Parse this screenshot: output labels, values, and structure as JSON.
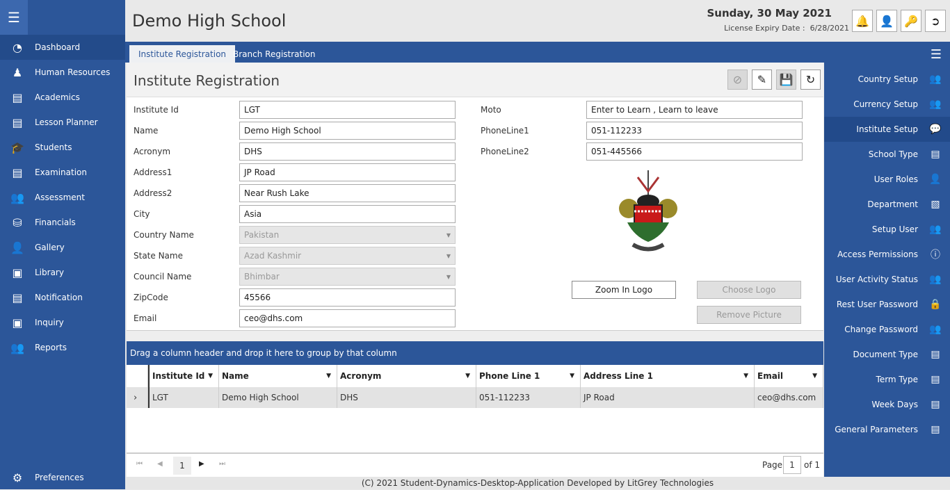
{
  "header": {
    "title": "Demo High School",
    "date": "Sunday, 30 May 2021",
    "license_label": "License Expiry Date :",
    "license_date": "6/28/2021"
  },
  "left_menu": [
    {
      "label": "Dashboard",
      "icon": "gauge-icon"
    },
    {
      "label": "Human Resources",
      "icon": "person-icon"
    },
    {
      "label": "Academics",
      "icon": "book-icon"
    },
    {
      "label": "Lesson Planner",
      "icon": "book-icon"
    },
    {
      "label": "Students",
      "icon": "graduate-icon"
    },
    {
      "label": "Examination",
      "icon": "list-icon"
    },
    {
      "label": "Assessment",
      "icon": "users-icon"
    },
    {
      "label": "Financials",
      "icon": "coins-icon"
    },
    {
      "label": "Gallery",
      "icon": "user-edit-icon"
    },
    {
      "label": "Library",
      "icon": "library-icon"
    },
    {
      "label": "Notification",
      "icon": "notification-icon"
    },
    {
      "label": "Inquiry",
      "icon": "inquiry-icon"
    },
    {
      "label": "Reports",
      "icon": "users-icon"
    }
  ],
  "preferences_label": "Preferences",
  "tabs": [
    "Institute Registration",
    "Branch Registration"
  ],
  "right_menu": [
    "Country Setup",
    "Currency Setup",
    "Institute Setup",
    "School Type",
    "User Roles",
    "Department",
    "Setup User",
    "Access Permissions",
    "User Activity Status",
    "Rest User Password",
    "Change Password",
    "Document Type",
    "Term Type",
    "Week Days",
    "General Parameters"
  ],
  "form": {
    "title": "Institute Registration",
    "left": [
      {
        "label": "Institute Id",
        "value": "LGT"
      },
      {
        "label": "Name",
        "value": "Demo High School"
      },
      {
        "label": "Acronym",
        "value": "DHS"
      },
      {
        "label": "Address1",
        "value": "JP Road"
      },
      {
        "label": "Address2",
        "value": "Near Rush Lake"
      },
      {
        "label": "City",
        "value": "Asia"
      },
      {
        "label": "Country Name",
        "value": "Pakistan",
        "select": true
      },
      {
        "label": "State Name",
        "value": "Azad Kashmir",
        "select": true
      },
      {
        "label": "Council Name",
        "value": "Bhimbar",
        "select": true
      },
      {
        "label": "ZipCode",
        "value": "45566"
      },
      {
        "label": "Email",
        "value": "ceo@dhs.com"
      }
    ],
    "right": [
      {
        "label": "Moto",
        "value": "Enter to Learn , Learn to leave"
      },
      {
        "label": "PhoneLine1",
        "value": "051-112233"
      },
      {
        "label": "PhoneLine2",
        "value": "051-445566"
      }
    ],
    "zoom_logo": "Zoom In Logo",
    "choose_logo": "Choose Logo",
    "remove_picture": "Remove Picture"
  },
  "grid": {
    "group_hint": "Drag a column header and drop it here to group by that column",
    "columns": [
      "Institute Id",
      "Name",
      "Acronym",
      "Phone Line 1",
      "Address Line 1",
      "Email"
    ],
    "rows": [
      [
        "LGT",
        "Demo High School",
        "DHS",
        "051-112233",
        "JP Road",
        "ceo@dhs.com"
      ]
    ],
    "page": "1",
    "page_label": "Page",
    "page_input": "1",
    "of_label": "of 1"
  },
  "footer": "(C) 2021 Student-Dynamics-Desktop-Application Developed by LitGrey Technologies"
}
